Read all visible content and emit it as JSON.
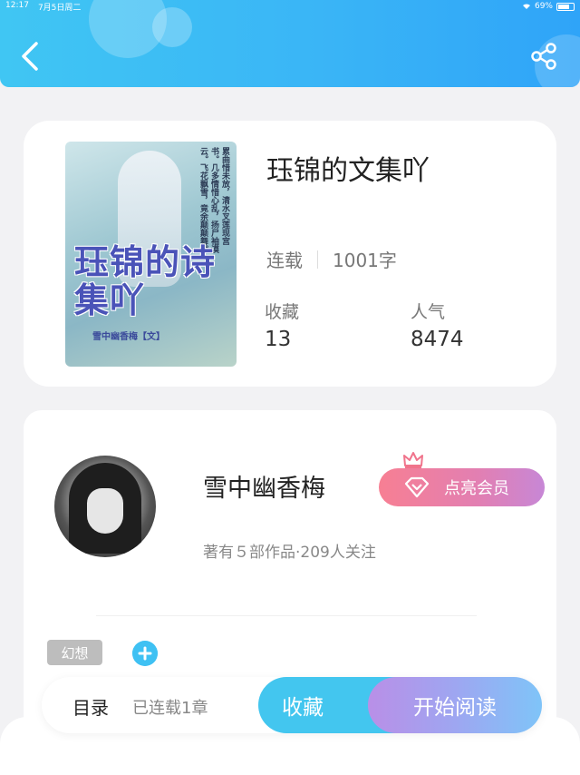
{
  "status_bar": {
    "time": "12:17",
    "date": "7月5日周二",
    "battery": "69%"
  },
  "header": {
    "back_icon": "chevron-left-icon",
    "share_icon": "share-icon",
    "gradient_colors": [
      "#40c6f3",
      "#2fa4f8"
    ]
  },
  "book": {
    "title": "珏锦的文集吖",
    "cover_title": "珏锦的诗集吖",
    "cover_author": "雪中幽香梅【文】",
    "cover_verse": "累曲惜未放，清水叉莲现宫书。几多情惜心乱，扬尸袖漠云。飞花飘雪，竟余颠颠舞。",
    "status": "连载",
    "word_count": "1001字",
    "favorites_label": "收藏",
    "favorites_value": "13",
    "popularity_label": "人气",
    "popularity_value": "8474"
  },
  "author": {
    "name": "雪中幽香梅",
    "info": "著有５部作品·209人关注",
    "vip_button_label": "点亮会员",
    "vip_colors": [
      "#f77f93",
      "#c787d6"
    ]
  },
  "tags": {
    "items": [
      "幻想"
    ],
    "add_icon": "plus-icon"
  },
  "action_bar": {
    "toc_label": "目录",
    "serial_label": "已连载1章",
    "favorite_button": "收藏",
    "read_button": "开始阅读"
  }
}
